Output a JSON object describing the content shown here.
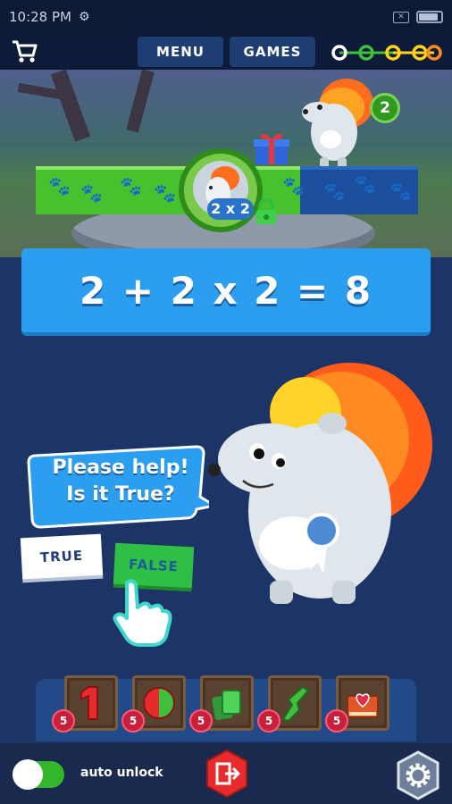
{
  "status_bar": {
    "time": "10:28 PM",
    "settings_icon": "gear-icon",
    "close_icon": "x-box-icon",
    "battery_icon": "battery-icon"
  },
  "nav": {
    "cart_icon": "shopping-cart-icon",
    "menu_label": "MENU",
    "games_label": "GAMES",
    "progress_nodes": 5,
    "progress_colors": [
      "#ffffff",
      "#3fbf3a",
      "#ffd21f",
      "#ff8a1e"
    ]
  },
  "scene": {
    "badge_label": "2 x 2",
    "level": "2",
    "gift_icon": "gift-icon",
    "lock_icon": "padlock-icon"
  },
  "question": {
    "equation": "2 + 2 x 2 = 8"
  },
  "bubble": {
    "line1": "Please help!",
    "line2": "Is it True?"
  },
  "answers": {
    "true_label": "TRUE",
    "false_label": "FALSE"
  },
  "powerups": [
    {
      "icon": "number-one-icon",
      "count": "5"
    },
    {
      "icon": "split-circle-icon",
      "count": "5"
    },
    {
      "icon": "cards-icon",
      "count": "5"
    },
    {
      "icon": "green-pointer-icon",
      "count": "5"
    },
    {
      "icon": "book-heart-icon",
      "count": "5"
    }
  ],
  "footer": {
    "auto_unlock_label": "auto unlock",
    "auto_unlock_on": true,
    "exit_icon": "exit-door-icon",
    "settings_icon": "gear-icon"
  },
  "colors": {
    "accent_blue": "#2b9ef0",
    "accent_green": "#48c12e",
    "badge_red": "#c81f3a",
    "background": "#1d3466"
  }
}
